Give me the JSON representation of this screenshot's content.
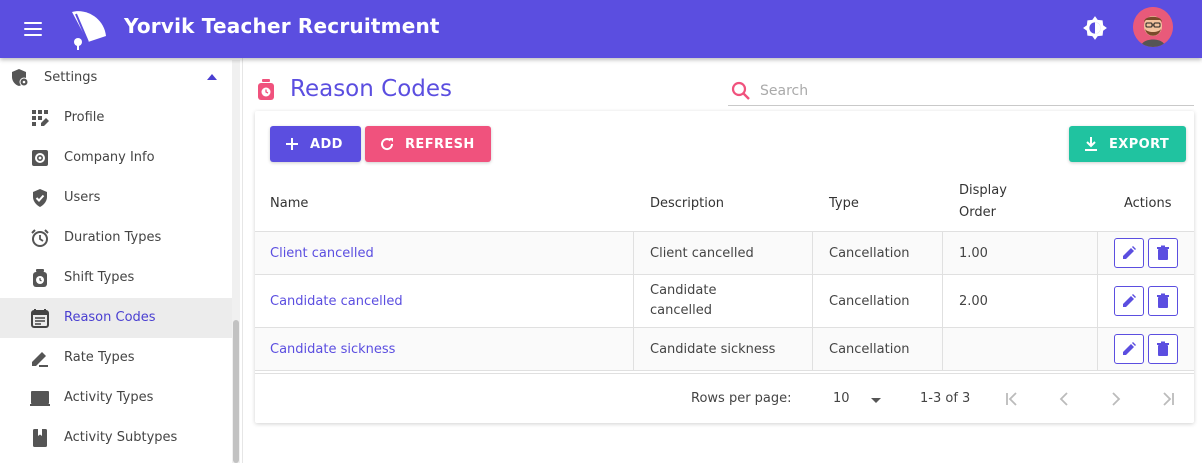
{
  "app": {
    "title": "Yorvik Teacher Recruitment",
    "accent": "#5b4ee0",
    "menu_icon": "hamburger-menu-icon",
    "logo_icon": "logo-icon",
    "theme_icon": "brightness-icon",
    "avatar_icon": "avatar"
  },
  "sidebar": {
    "section": {
      "label": "Settings",
      "icon": "shield-gear-icon",
      "expanded": true
    },
    "items": [
      {
        "label": "Profile",
        "icon": "dashboard-icon",
        "active": false
      },
      {
        "label": "Company Info",
        "icon": "gear-icon",
        "active": false
      },
      {
        "label": "Users",
        "icon": "shield-check-icon",
        "active": false
      },
      {
        "label": "Duration Types",
        "icon": "alarm-clock-icon",
        "active": false
      },
      {
        "label": "Shift Types",
        "icon": "stopwatch-icon",
        "active": false
      },
      {
        "label": "Reason Codes",
        "icon": "calendar-notes-icon",
        "active": true
      },
      {
        "label": "Rate Types",
        "icon": "signature-icon",
        "active": false
      },
      {
        "label": "Activity Types",
        "icon": "laptop-icon",
        "active": false
      },
      {
        "label": "Activity Subtypes",
        "icon": "book-icon",
        "active": false
      }
    ]
  },
  "page": {
    "title": "Reason Codes",
    "icon": "stopwatch-icon",
    "search": {
      "placeholder": "Search",
      "value": ""
    }
  },
  "toolbar": {
    "add_label": "ADD",
    "refresh_label": "REFRESH",
    "export_label": "EXPORT",
    "add_color": "#5b4ee0",
    "refresh_color": "#f0527d",
    "export_color": "#20c3a0"
  },
  "table": {
    "columns": {
      "name": "Name",
      "description": "Description",
      "type": "Type",
      "display_order_line1": "Display",
      "display_order_line2": "Order",
      "actions": "Actions"
    },
    "rows": [
      {
        "name": "Client cancelled",
        "description": "Client cancelled",
        "type": "Cancellation",
        "display_order": "1.00"
      },
      {
        "name": "Candidate cancelled",
        "description_line1": "Candidate",
        "description_line2": "cancelled",
        "type": "Cancellation",
        "display_order": "2.00"
      },
      {
        "name": "Candidate sickness",
        "description": "Candidate sickness",
        "type": "Cancellation",
        "display_order": ""
      }
    ]
  },
  "pagination": {
    "rows_per_page_label": "Rows per page:",
    "rows_per_page": "10",
    "range": "1-3 of 3"
  }
}
